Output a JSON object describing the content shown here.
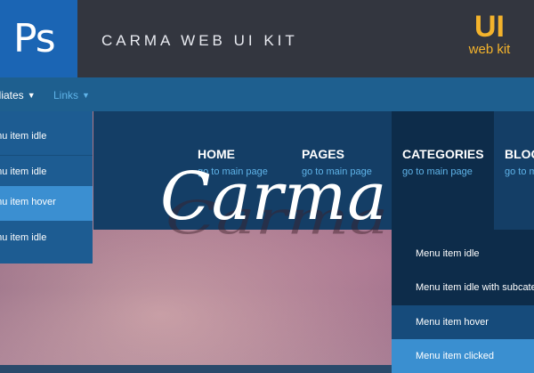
{
  "header": {
    "app_icon_text": "Ps",
    "title": "CARMA WEB UI KIT",
    "badge_big": "UI",
    "badge_small": "web kit",
    "accent": "#f4b32c",
    "ps_blue": "#1b65b4"
  },
  "subbar": {
    "items": [
      {
        "label": "lliates",
        "chevron": "chevron-down-icon"
      },
      {
        "label": "Links",
        "chevron": "chevron-down-icon"
      }
    ]
  },
  "main_nav": {
    "items": [
      {
        "label": "HOME",
        "sub": "go to main page"
      },
      {
        "label": "PAGES",
        "sub": "go to main page"
      },
      {
        "label": "CATEGORIES",
        "sub": "go to main page"
      },
      {
        "label": "BLOG",
        "sub": "go to m"
      }
    ]
  },
  "left_dropdown": {
    "items": [
      {
        "label": "enu item idle"
      },
      {
        "label": "enu item idle"
      },
      {
        "label": "enu item hover"
      },
      {
        "label": "enu item idle"
      }
    ]
  },
  "right_dropdown": {
    "items": [
      {
        "label": "Menu item idle"
      },
      {
        "label": "Menu item idle with subcate"
      },
      {
        "label": "Menu item hover"
      },
      {
        "label": "Menu item clicked"
      }
    ]
  },
  "hero": {
    "script_text": "Carma"
  }
}
